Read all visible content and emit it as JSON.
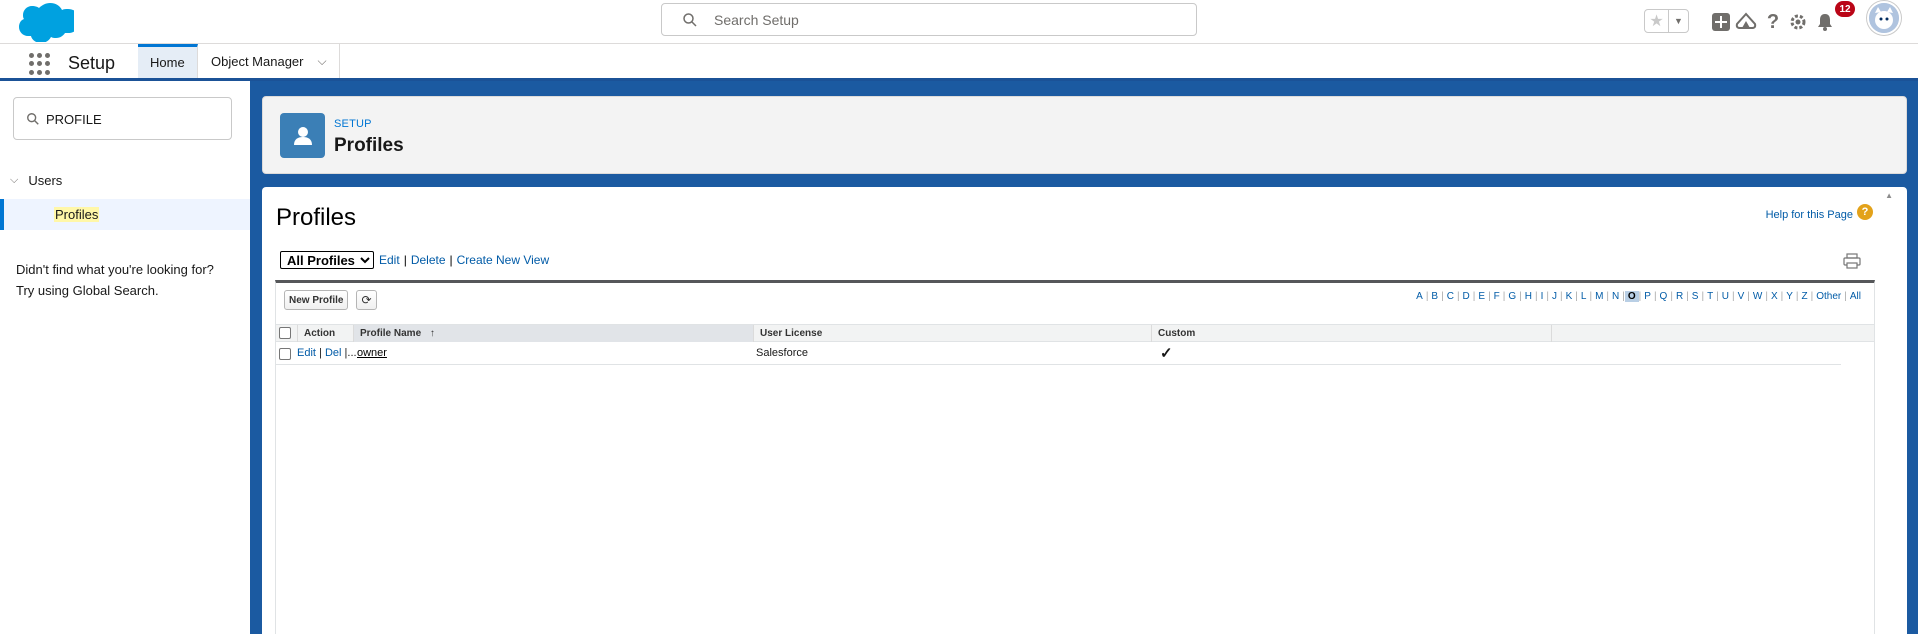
{
  "header": {
    "search_placeholder": "Search Setup",
    "notification_count": "12"
  },
  "context_bar": {
    "app_name": "Setup",
    "tabs": [
      {
        "label": "Home"
      },
      {
        "label": "Object Manager"
      }
    ]
  },
  "sidebar": {
    "quick_find_value": "PROFILE",
    "tree_parent": "Users",
    "tree_child": "Profiles",
    "help_line1": "Didn't find what you're looking for?",
    "help_line2": "Try using Global Search."
  },
  "page_header": {
    "eyebrow": "SETUP",
    "title": "Profiles"
  },
  "content": {
    "title": "Profiles",
    "help_link": "Help for this Page",
    "view_select": "All Profiles",
    "view_links": {
      "edit": "Edit",
      "delete": "Delete",
      "create": "Create New View"
    },
    "new_button": "New Profile",
    "alpha_letters": [
      "A",
      "B",
      "C",
      "D",
      "E",
      "F",
      "G",
      "H",
      "I",
      "J",
      "K",
      "L",
      "M",
      "N",
      "O",
      "P",
      "Q",
      "R",
      "S",
      "T",
      "U",
      "V",
      "W",
      "X",
      "Y",
      "Z",
      "Other",
      "All"
    ],
    "alpha_selected": "O",
    "columns": {
      "action": "Action",
      "name": "Profile Name",
      "license": "User License",
      "custom": "Custom"
    },
    "sort_indicator": "↑",
    "rows": [
      {
        "edit": "Edit",
        "del": "Del",
        "more": "|...",
        "name": "owner",
        "license": "Salesforce",
        "custom": "✓"
      }
    ]
  },
  "colors": {
    "brand_blue": "#1b5aa1",
    "link_blue": "#015ba7",
    "accent": "#0176d3",
    "badge_red": "#ba0517"
  },
  "icons": [
    "salesforce-cloud-logo",
    "search-icon",
    "star-icon",
    "add-icon",
    "trailhead-icon",
    "help-icon",
    "gear-icon",
    "bell-icon",
    "app-launcher-icon",
    "user-profile-icon",
    "print-icon",
    "refresh-icon"
  ]
}
